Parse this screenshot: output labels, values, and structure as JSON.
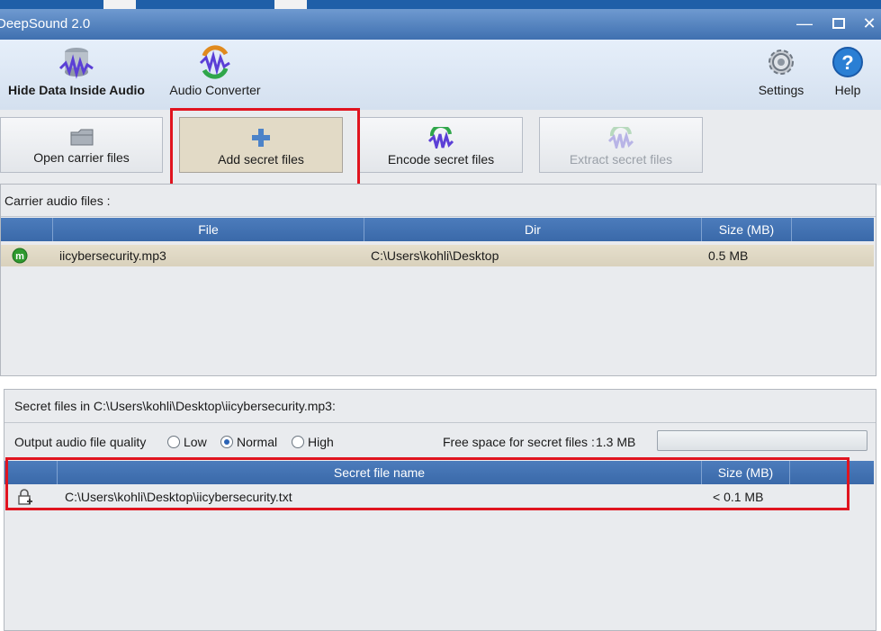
{
  "window": {
    "title": "DeepSound 2.0",
    "minimize_icon": "minimize-icon",
    "maximize_icon": "maximize-icon",
    "close_icon": "close-icon"
  },
  "ribbon": {
    "hide_data_label": "Hide Data Inside Audio",
    "audio_converter_label": "Audio Converter",
    "settings_label": "Settings",
    "help_label": "Help"
  },
  "toolbar": {
    "open_carrier_label": "Open carrier files",
    "add_secret_label": "Add secret files",
    "encode_secret_label": "Encode secret files",
    "extract_secret_label": "Extract secret files"
  },
  "carrier": {
    "section_label": "Carrier audio files :",
    "columns": [
      "",
      "File",
      "Dir",
      "Size (MB)"
    ],
    "rows": [
      {
        "file": "iicybersecurity.mp3",
        "dir": "C:\\Users\\kohli\\Desktop",
        "size": "0.5 MB"
      }
    ]
  },
  "secret": {
    "section_label": "Secret files in C:\\Users\\kohli\\Desktop\\iicybersecurity.mp3:",
    "quality_label": "Output audio file quality",
    "quality_options": [
      "Low",
      "Normal",
      "High"
    ],
    "quality_selected": "Normal",
    "free_space_label": "Free space for secret files :",
    "free_space_value": "1.3 MB",
    "columns": [
      "",
      "Secret file name",
      "Size (MB)"
    ],
    "rows": [
      {
        "name": "C:\\Users\\kohli\\Desktop\\iicybersecurity.txt",
        "size": "< 0.1 MB"
      }
    ]
  },
  "colors": {
    "titlebar": "#4a7dbd",
    "grid_header": "#4473b3",
    "highlight": "#e0141f",
    "selected_row": "#e0d8c4"
  }
}
